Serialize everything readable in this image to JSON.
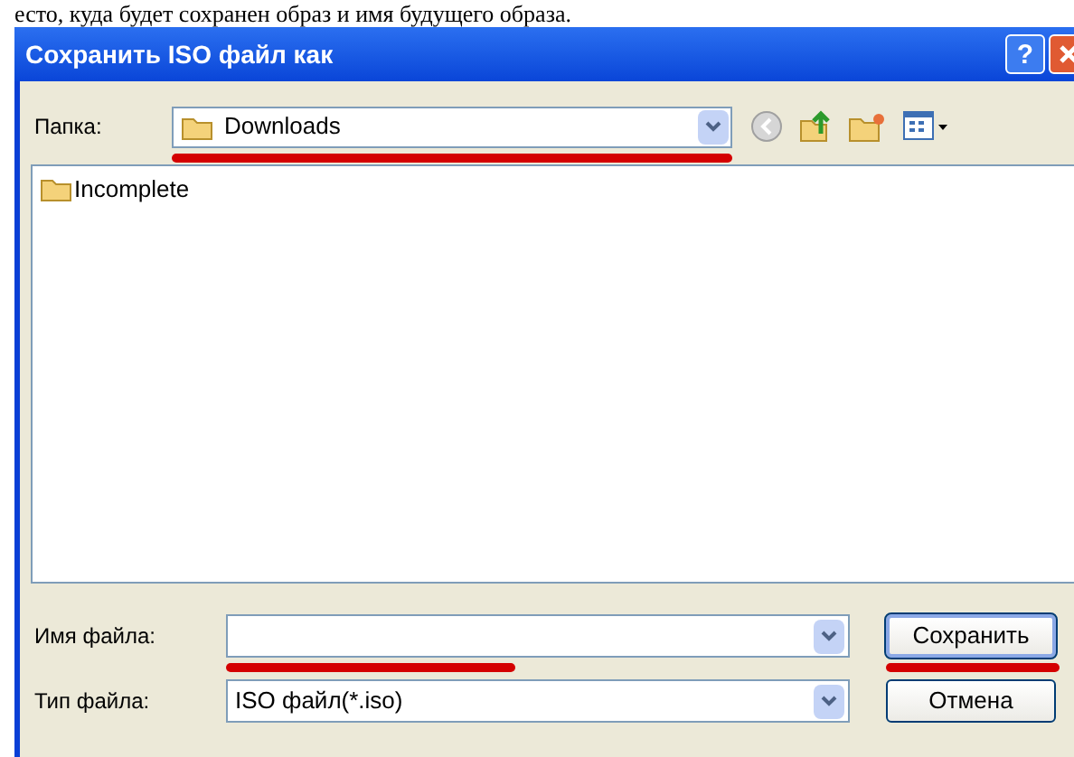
{
  "caption": "есто, куда будет сохранен образ и имя будущего образа.",
  "window": {
    "title": "Сохранить ISO файл как",
    "help_button": "?"
  },
  "folder_bar": {
    "label": "Папка:",
    "value": "Downloads"
  },
  "files": [
    {
      "name": "Incomplete",
      "selected": false
    }
  ],
  "file_name": {
    "label": "Имя файла:"
  },
  "file_type": {
    "label": "Тип файла:",
    "value": "ISO файл(*.iso)"
  },
  "buttons": [
    {
      "label": "Сохранить",
      "default": true
    },
    {
      "label": "Отмена",
      "default": false
    }
  ]
}
